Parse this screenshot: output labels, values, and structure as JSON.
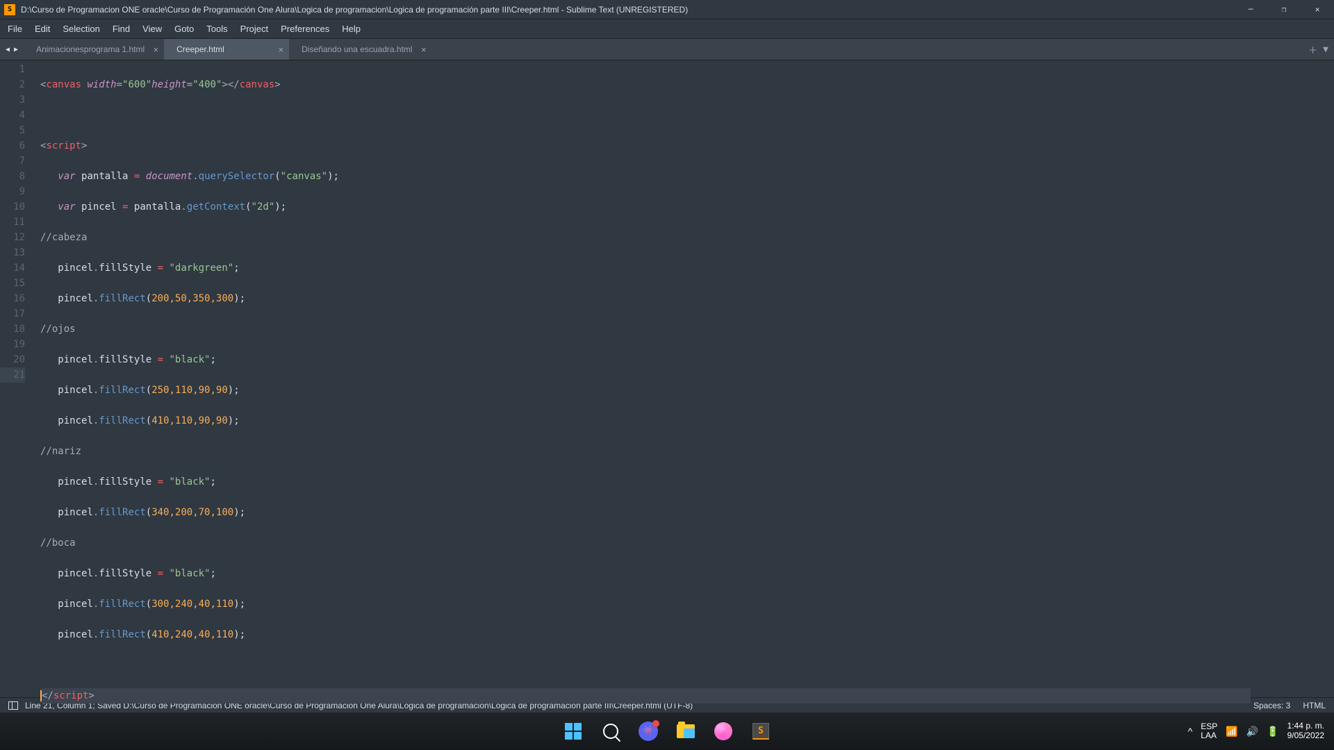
{
  "window": {
    "title": "D:\\Curso de Programacion ONE oracle\\Curso de Programación One Alura\\Logica de programacion\\Logica de programación parte III\\Creeper.html - Sublime Text (UNREGISTERED)"
  },
  "menus": [
    "File",
    "Edit",
    "Selection",
    "Find",
    "View",
    "Goto",
    "Tools",
    "Project",
    "Preferences",
    "Help"
  ],
  "tabs": [
    {
      "label": "Animacionesprograma 1.html",
      "active": false
    },
    {
      "label": "Creeper.html",
      "active": true
    },
    {
      "label": "Diseñando una escuadra.html",
      "active": false
    }
  ],
  "code": {
    "current_line": 21,
    "canvas": {
      "width": "600",
      "height": "400"
    },
    "vars": {
      "pantalla": "pantalla",
      "pincel": "pincel",
      "document": "document",
      "querySelector": "querySelector",
      "getContext": "getContext",
      "canvas_sel": "\"canvas\"",
      "ctx_2d": "\"2d\""
    },
    "comments": {
      "cabeza": "//cabeza",
      "ojos": "//ojos",
      "nariz": "//nariz",
      "boca": "//boca"
    },
    "fills": {
      "darkgreen": "\"darkgreen\"",
      "black": "\"black\""
    },
    "rects": {
      "head": "200,50,350,300",
      "eye1": "250,110,90,90",
      "eye2": "410,110,90,90",
      "nose": "340,200,70,100",
      "mouth1": "300,240,40,110",
      "mouth2": "410,240,40,110"
    }
  },
  "status": {
    "left": "Line 21, Column 1; Saved D:\\Curso de Programacion ONE oracle\\Curso de Programación One Alura\\Logica de programacion\\Logica de programación parte III\\Creeper.html (UTF-8)",
    "spaces": "Spaces: 3",
    "syntax": "HTML"
  },
  "taskbar": {
    "tray_chevron": "^",
    "lang1": "ESP",
    "lang2": "LAA",
    "time": "1:44 p. m.",
    "date": "9/05/2022"
  }
}
